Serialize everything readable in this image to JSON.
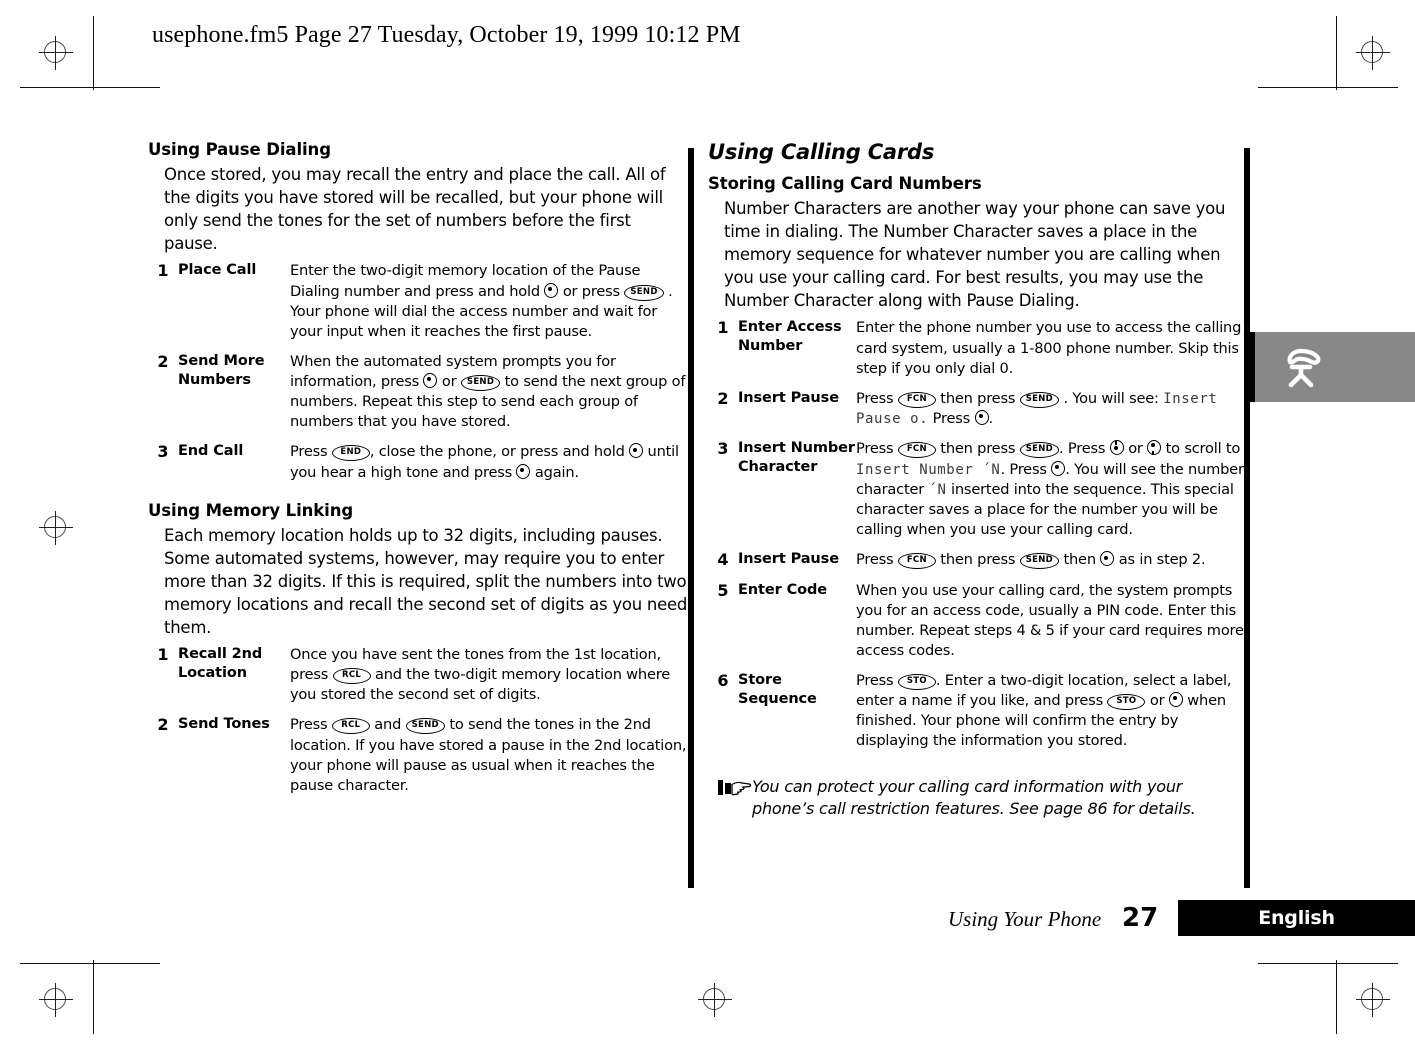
{
  "header": {
    "running_head": "usephone.fm5  Page 27  Tuesday, October 19, 1999  10:12 PM"
  },
  "left_column": {
    "sections": [
      {
        "heading": "Using Pause Dialing",
        "intro": "Once stored, you may recall the entry and place the call. All of the digits you have stored will be recalled, but your phone will only send the tones for the set of numbers before the first pause.",
        "steps": [
          {
            "number": "1",
            "label": "Place Call",
            "body_parts": [
              {
                "t": "text",
                "v": "Enter the two-digit memory location of the Pause Dialing number and press and hold "
              },
              {
                "t": "smartkey",
                "v": "select-key"
              },
              {
                "t": "text",
                "v": " or press "
              },
              {
                "t": "key",
                "v": "SEND"
              },
              {
                "t": "text",
                "v": " . Your phone will dial the access number and wait for your input when it reaches the first pause."
              }
            ]
          },
          {
            "number": "2",
            "label": "Send More Numbers",
            "body_parts": [
              {
                "t": "text",
                "v": "When the automated system prompts you for information, press "
              },
              {
                "t": "smartkey",
                "v": "select-key"
              },
              {
                "t": "text",
                "v": " or "
              },
              {
                "t": "key",
                "v": "SEND"
              },
              {
                "t": "text",
                "v": " to send the next group of numbers. Repeat this step to send each group of numbers that you have stored."
              }
            ]
          },
          {
            "number": "3",
            "label": "End Call",
            "body_parts": [
              {
                "t": "text",
                "v": "Press "
              },
              {
                "t": "key",
                "v": "END"
              },
              {
                "t": "text",
                "v": ", close the phone, or press and hold "
              },
              {
                "t": "smartkey",
                "v": "select-key"
              },
              {
                "t": "text",
                "v": " until you hear a high tone and press "
              },
              {
                "t": "smartkey",
                "v": "select-key"
              },
              {
                "t": "text",
                "v": " again."
              }
            ]
          }
        ]
      },
      {
        "heading": "Using Memory Linking",
        "intro": "Each memory location holds up to 32 digits, including pauses. Some automated systems, however, may require you to enter more than 32 digits. If this is required, split the numbers into two memory locations and recall the second set of digits as you need them.",
        "steps": [
          {
            "number": "1",
            "label": "Recall 2nd Location",
            "body_parts": [
              {
                "t": "text",
                "v": "Once you have sent the tones from the 1st location, press "
              },
              {
                "t": "key",
                "v": "RCL"
              },
              {
                "t": "text",
                "v": " and the two-digit memory location where you stored the second set of digits."
              }
            ]
          },
          {
            "number": "2",
            "label": "Send Tones",
            "body_parts": [
              {
                "t": "text",
                "v": "Press "
              },
              {
                "t": "key",
                "v": "RCL"
              },
              {
                "t": "text",
                "v": " and "
              },
              {
                "t": "key",
                "v": "SEND"
              },
              {
                "t": "text",
                "v": " to send the tones in the 2nd location. If you have stored a pause in the 2nd location, your phone will pause as usual when it reaches the pause character."
              }
            ]
          }
        ]
      }
    ]
  },
  "right_column": {
    "heading": "Using Calling Cards",
    "sub_heading": "Storing Calling Card Numbers",
    "intro": "Number Characters are another way your phone can save you time in dialing. The Number Character saves a place in the memory sequence for whatever number you are calling when you use your calling card. For best results, you may use the Number Character along with Pause Dialing.",
    "steps": [
      {
        "number": "1",
        "label": "Enter Access Number",
        "body_parts": [
          {
            "t": "text",
            "v": "Enter the phone number you use to access the calling card system, usually a 1-800 phone number. Skip this step if you only dial 0."
          }
        ]
      },
      {
        "number": "2",
        "label": "Insert Pause",
        "body_parts": [
          {
            "t": "text",
            "v": "Press "
          },
          {
            "t": "key",
            "v": "FCN"
          },
          {
            "t": "text",
            "v": " then press "
          },
          {
            "t": "key",
            "v": "SEND"
          },
          {
            "t": "text",
            "v": " . You will see: "
          },
          {
            "t": "lcd",
            "v": "Insert Pause o."
          },
          {
            "t": "text",
            "v": " Press "
          },
          {
            "t": "smartkey",
            "v": "select-key"
          },
          {
            "t": "text",
            "v": "."
          }
        ]
      },
      {
        "number": "3",
        "label": "Insert Number Character",
        "body_parts": [
          {
            "t": "text",
            "v": "Press "
          },
          {
            "t": "key",
            "v": "FCN"
          },
          {
            "t": "text",
            "v": " then press "
          },
          {
            "t": "key",
            "v": "SEND"
          },
          {
            "t": "text",
            "v": ". Press "
          },
          {
            "t": "smartkey-up",
            "v": "scroll-up-key"
          },
          {
            "t": "text",
            "v": " or "
          },
          {
            "t": "smartkey-dn",
            "v": "scroll-down-key"
          },
          {
            "t": "text",
            "v": " to scroll to "
          },
          {
            "t": "lcd",
            "v": "Insert Number ´N"
          },
          {
            "t": "text",
            "v": ". Press "
          },
          {
            "t": "smartkey",
            "v": "select-key"
          },
          {
            "t": "text",
            "v": ". You will see the number character "
          },
          {
            "t": "lcd",
            "v": "´N"
          },
          {
            "t": "text",
            "v": " inserted into the sequence. This special character saves a place for the number you will be calling when you use your calling card."
          }
        ]
      },
      {
        "number": "4",
        "label": "Insert Pause",
        "body_parts": [
          {
            "t": "text",
            "v": "Press "
          },
          {
            "t": "key",
            "v": "FCN"
          },
          {
            "t": "text",
            "v": " then press "
          },
          {
            "t": "key",
            "v": "SEND"
          },
          {
            "t": "text",
            "v": " then "
          },
          {
            "t": "smartkey",
            "v": "select-key"
          },
          {
            "t": "text",
            "v": " as in step 2."
          }
        ]
      },
      {
        "number": "5",
        "label": "Enter Code",
        "body_parts": [
          {
            "t": "text",
            "v": "When you use your calling card, the system prompts you for an access code, usually a PIN code. Enter this number. Repeat steps 4 & 5 if your card requires more access codes."
          }
        ]
      },
      {
        "number": "6",
        "label": "Store Sequence",
        "body_parts": [
          {
            "t": "text",
            "v": "Press "
          },
          {
            "t": "key",
            "v": "STO"
          },
          {
            "t": "text",
            "v": ". Enter a two-digit location, select a label, enter a name if you like, and press "
          },
          {
            "t": "key",
            "v": "STO"
          },
          {
            "t": "text",
            "v": " or "
          },
          {
            "t": "smartkey",
            "v": "select-key"
          },
          {
            "t": "text",
            "v": " when finished. Your phone will confirm the entry by displaying the information you stored."
          }
        ]
      }
    ],
    "note": "You can protect your calling card information with your phone’s call restriction features. See page 86 for details."
  },
  "footer": {
    "chapter": "Using Your Phone",
    "page_number": "27",
    "language": "English"
  },
  "colors": {
    "tab_gray": "#888888",
    "rule_black": "#000000",
    "lcd_gray": "#3b3b3b"
  }
}
